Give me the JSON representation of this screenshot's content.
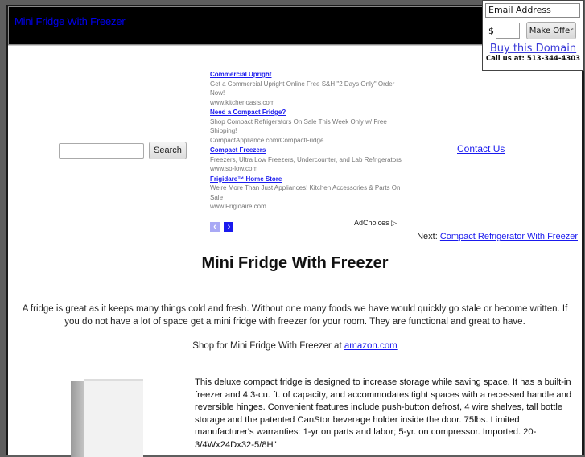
{
  "header": {
    "title": "Mini Fridge With Freezer"
  },
  "offer": {
    "email_placeholder": "Email Address",
    "currency": "$",
    "amount_value": "",
    "make_offer_label": "Make Offer",
    "buy_domain_label": "Buy this Domain",
    "call_text": "Call us at: 513-344-4303"
  },
  "search": {
    "input_value": "",
    "button_label": "Search"
  },
  "ads": {
    "items": [
      {
        "title": "Commercial Upright",
        "desc": "Get a Commercial Upright Online Free S&H \"2 Days Only\" Order Now!",
        "url": "www.kitchenoasis.com"
      },
      {
        "title": "Need a Compact Fridge?",
        "desc": "Shop Compact Refrigerators On Sale This Week Only w/ Free Shipping!",
        "url": "CompactAppliance.com/CompactFridge"
      },
      {
        "title": "Compact Freezers",
        "desc": "Freezers, Ultra Low Freezers, Undercounter, and Lab Refrigerators",
        "url": "www.so-low.com"
      },
      {
        "title": "Frigidare™ Home Store",
        "desc": "We're More Than Just Appliances! Kitchen Accessories & Parts On Sale",
        "url": "www.Frigidaire.com"
      }
    ],
    "prev_icon": "‹",
    "next_icon": "›",
    "adchoices_label": "AdChoices ▷"
  },
  "nav": {
    "contact_label": "Contact Us",
    "next_prefix": "Next: ",
    "next_link": "Compact Refrigerator With Freezer"
  },
  "main": {
    "title": "Mini Fridge With Freezer",
    "intro": "A fridge is great as it keeps many things cold and fresh. Without one many foods we have would quickly go stale or become written. If you do not have a lot of space get a mini fridge with freezer for your room. They are functional and great to have.",
    "shop_prefix": "Shop for Mini Fridge With Freezer at ",
    "shop_link": "amazon.com",
    "product_desc": "This deluxe compact fridge is designed to increase storage while saving space. It has a built-in freezer and 4.3-cu. ft. of capacity, and accommodates tight spaces with a recessed handle and reversible hinges. Convenient features include push-button defrost, 4 wire shelves, tall bottle storage and the patented CanStor beverage holder inside the door. 75lbs. Limited manufacturer's warranties: 1-yr on parts and labor; 5-yr. on compressor. Imported. 20-3/4Wx24Dx32-5/8H\""
  }
}
